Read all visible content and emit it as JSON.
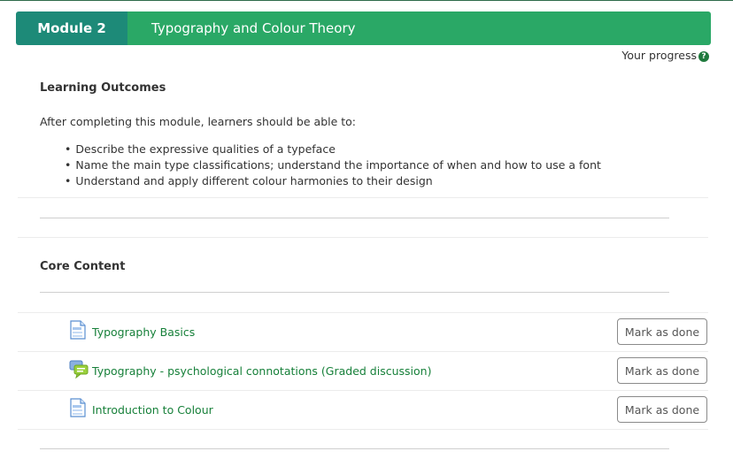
{
  "header": {
    "module_label": "Module 2",
    "module_title": "Typography and Colour Theory"
  },
  "progress": {
    "label": "Your progress",
    "help_icon": "?"
  },
  "learning_outcomes": {
    "heading": "Learning Outcomes",
    "intro": "After completing this module, learners should be able to:",
    "items": [
      "Describe the expressive qualities of a typeface",
      "Name the main type classifications; understand the importance of when and how to use a font",
      "Understand and apply different colour harmonies to their design"
    ]
  },
  "core_content": {
    "heading": "Core Content",
    "activities": [
      {
        "title": "Typography Basics",
        "icon": "page-icon",
        "button": "Mark as done"
      },
      {
        "title": "Typography - psychological connotations (Graded discussion)",
        "icon": "forum-icon",
        "button": "Mark as done"
      },
      {
        "title": "Introduction to Colour",
        "icon": "page-icon",
        "button": "Mark as done"
      }
    ]
  },
  "colors": {
    "badge_bg": "#1d8a78",
    "title_bg": "#2aa866",
    "link": "#17803a"
  }
}
